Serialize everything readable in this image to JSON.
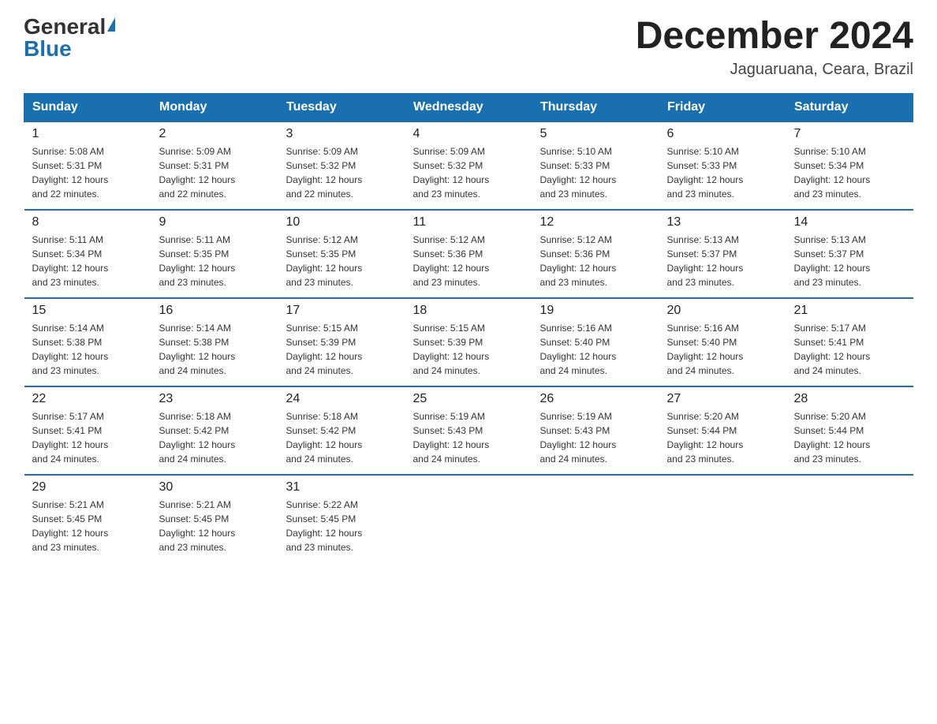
{
  "header": {
    "logo_general": "General",
    "logo_blue": "Blue",
    "month_title": "December 2024",
    "subtitle": "Jaguaruana, Ceara, Brazil"
  },
  "weekdays": [
    "Sunday",
    "Monday",
    "Tuesday",
    "Wednesday",
    "Thursday",
    "Friday",
    "Saturday"
  ],
  "weeks": [
    [
      {
        "day": "1",
        "sunrise": "5:08 AM",
        "sunset": "5:31 PM",
        "daylight": "12 hours and 22 minutes."
      },
      {
        "day": "2",
        "sunrise": "5:09 AM",
        "sunset": "5:31 PM",
        "daylight": "12 hours and 22 minutes."
      },
      {
        "day": "3",
        "sunrise": "5:09 AM",
        "sunset": "5:32 PM",
        "daylight": "12 hours and 22 minutes."
      },
      {
        "day": "4",
        "sunrise": "5:09 AM",
        "sunset": "5:32 PM",
        "daylight": "12 hours and 23 minutes."
      },
      {
        "day": "5",
        "sunrise": "5:10 AM",
        "sunset": "5:33 PM",
        "daylight": "12 hours and 23 minutes."
      },
      {
        "day": "6",
        "sunrise": "5:10 AM",
        "sunset": "5:33 PM",
        "daylight": "12 hours and 23 minutes."
      },
      {
        "day": "7",
        "sunrise": "5:10 AM",
        "sunset": "5:34 PM",
        "daylight": "12 hours and 23 minutes."
      }
    ],
    [
      {
        "day": "8",
        "sunrise": "5:11 AM",
        "sunset": "5:34 PM",
        "daylight": "12 hours and 23 minutes."
      },
      {
        "day": "9",
        "sunrise": "5:11 AM",
        "sunset": "5:35 PM",
        "daylight": "12 hours and 23 minutes."
      },
      {
        "day": "10",
        "sunrise": "5:12 AM",
        "sunset": "5:35 PM",
        "daylight": "12 hours and 23 minutes."
      },
      {
        "day": "11",
        "sunrise": "5:12 AM",
        "sunset": "5:36 PM",
        "daylight": "12 hours and 23 minutes."
      },
      {
        "day": "12",
        "sunrise": "5:12 AM",
        "sunset": "5:36 PM",
        "daylight": "12 hours and 23 minutes."
      },
      {
        "day": "13",
        "sunrise": "5:13 AM",
        "sunset": "5:37 PM",
        "daylight": "12 hours and 23 minutes."
      },
      {
        "day": "14",
        "sunrise": "5:13 AM",
        "sunset": "5:37 PM",
        "daylight": "12 hours and 23 minutes."
      }
    ],
    [
      {
        "day": "15",
        "sunrise": "5:14 AM",
        "sunset": "5:38 PM",
        "daylight": "12 hours and 23 minutes."
      },
      {
        "day": "16",
        "sunrise": "5:14 AM",
        "sunset": "5:38 PM",
        "daylight": "12 hours and 24 minutes."
      },
      {
        "day": "17",
        "sunrise": "5:15 AM",
        "sunset": "5:39 PM",
        "daylight": "12 hours and 24 minutes."
      },
      {
        "day": "18",
        "sunrise": "5:15 AM",
        "sunset": "5:39 PM",
        "daylight": "12 hours and 24 minutes."
      },
      {
        "day": "19",
        "sunrise": "5:16 AM",
        "sunset": "5:40 PM",
        "daylight": "12 hours and 24 minutes."
      },
      {
        "day": "20",
        "sunrise": "5:16 AM",
        "sunset": "5:40 PM",
        "daylight": "12 hours and 24 minutes."
      },
      {
        "day": "21",
        "sunrise": "5:17 AM",
        "sunset": "5:41 PM",
        "daylight": "12 hours and 24 minutes."
      }
    ],
    [
      {
        "day": "22",
        "sunrise": "5:17 AM",
        "sunset": "5:41 PM",
        "daylight": "12 hours and 24 minutes."
      },
      {
        "day": "23",
        "sunrise": "5:18 AM",
        "sunset": "5:42 PM",
        "daylight": "12 hours and 24 minutes."
      },
      {
        "day": "24",
        "sunrise": "5:18 AM",
        "sunset": "5:42 PM",
        "daylight": "12 hours and 24 minutes."
      },
      {
        "day": "25",
        "sunrise": "5:19 AM",
        "sunset": "5:43 PM",
        "daylight": "12 hours and 24 minutes."
      },
      {
        "day": "26",
        "sunrise": "5:19 AM",
        "sunset": "5:43 PM",
        "daylight": "12 hours and 24 minutes."
      },
      {
        "day": "27",
        "sunrise": "5:20 AM",
        "sunset": "5:44 PM",
        "daylight": "12 hours and 23 minutes."
      },
      {
        "day": "28",
        "sunrise": "5:20 AM",
        "sunset": "5:44 PM",
        "daylight": "12 hours and 23 minutes."
      }
    ],
    [
      {
        "day": "29",
        "sunrise": "5:21 AM",
        "sunset": "5:45 PM",
        "daylight": "12 hours and 23 minutes."
      },
      {
        "day": "30",
        "sunrise": "5:21 AM",
        "sunset": "5:45 PM",
        "daylight": "12 hours and 23 minutes."
      },
      {
        "day": "31",
        "sunrise": "5:22 AM",
        "sunset": "5:45 PM",
        "daylight": "12 hours and 23 minutes."
      },
      null,
      null,
      null,
      null
    ]
  ]
}
